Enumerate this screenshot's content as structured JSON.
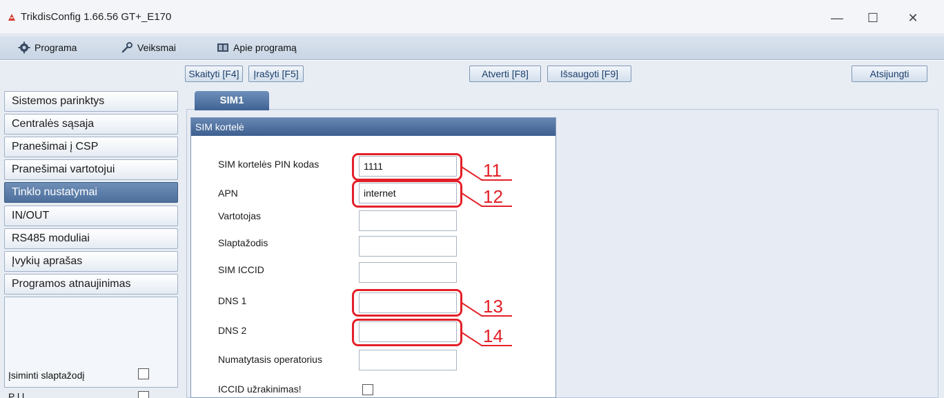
{
  "window": {
    "title": "TrikdisConfig 1.66.56   GT+_E170",
    "controls": {
      "minimize": "—",
      "maximize": "☐",
      "close": "✕"
    },
    "icon": "app-logo-icon"
  },
  "menu": {
    "programa": "Programa",
    "veiksmai": "Veiksmai",
    "apie": "Apie programą"
  },
  "toolbar": {
    "read": "Skaityti [F4]",
    "write": "Įrašyti [F5]",
    "open": "Atverti [F8]",
    "save": "Išsaugoti [F9]",
    "disconnect": "Atsijungti"
  },
  "nav": {
    "items": [
      {
        "label": "Sistemos parinktys"
      },
      {
        "label": "Centralės sąsaja"
      },
      {
        "label": "Pranešimai į CSP"
      },
      {
        "label": "Pranešimai vartotojui"
      },
      {
        "label": "Tinklo nustatymai",
        "active": true
      },
      {
        "label": "IN/OUT"
      },
      {
        "label": "RS485 moduliai"
      },
      {
        "label": "Įvykių aprašas"
      },
      {
        "label": "Programos atnaujinimas"
      }
    ],
    "remember_password": "Įsiminti slaptažodį",
    "second_option_partial": "P        l    l      "
  },
  "tabs": {
    "sim1": "SIM1"
  },
  "sim_group": {
    "title": "SIM kortelė",
    "fields": {
      "pin": {
        "label": "SIM kortelės PIN kodas",
        "value": "1111"
      },
      "apn": {
        "label": "APN",
        "value": "internet"
      },
      "user": {
        "label": "Vartotojas",
        "value": ""
      },
      "password": {
        "label": "Slaptažodis",
        "value": ""
      },
      "iccid": {
        "label": "SIM ICCID",
        "value": ""
      },
      "dns1": {
        "label": "DNS 1",
        "value": ""
      },
      "dns2": {
        "label": "DNS 2",
        "value": ""
      },
      "operator": {
        "label": "Numatytasis operatorius",
        "value": ""
      },
      "iccid_lock": {
        "label": "ICCID užrakinimas!"
      }
    }
  },
  "callouts": [
    "11",
    "12",
    "13",
    "14"
  ],
  "colors": {
    "accent_red": "#e32028",
    "active_nav": "#4d6f9b",
    "header_blue": "#3d5f8f"
  }
}
